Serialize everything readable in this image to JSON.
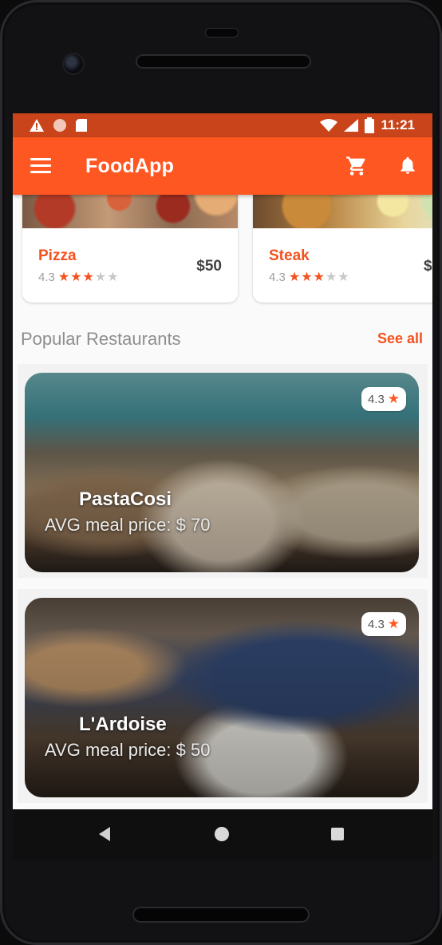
{
  "status_bar": {
    "time": "11:21",
    "left_icons": [
      "warning-icon",
      "circle-icon",
      "sd-card-icon"
    ],
    "right_icons": [
      "wifi-icon",
      "signal-icon",
      "battery-icon"
    ]
  },
  "app_bar": {
    "title": "FoodApp",
    "menu_icon": "menu-icon",
    "cart_icon": "cart-icon",
    "bell_icon": "bell-icon",
    "color": "#ff5722"
  },
  "food_items": [
    {
      "name": "Pizza",
      "rating": "4.3",
      "stars_filled": 3,
      "stars_total": 5,
      "price": "$50"
    },
    {
      "name": "Steak",
      "rating": "4.3",
      "stars_filled": 3,
      "stars_total": 5,
      "price": "$"
    }
  ],
  "popular": {
    "title": "Popular Restaurants",
    "see_all": "See all"
  },
  "restaurants": [
    {
      "name": "PastaCosi",
      "price_label": "AVG meal price: $ 70",
      "rating": "4.3"
    },
    {
      "name": "L'Ardoise",
      "price_label": "AVG meal price: $ 50",
      "rating": "4.3"
    }
  ],
  "nav_bar": {
    "icons": [
      "back-icon",
      "home-icon",
      "recents-icon"
    ]
  },
  "colors": {
    "accent": "#ff5722",
    "status_bar": "#c9441a",
    "food_name": "#f4511e"
  }
}
